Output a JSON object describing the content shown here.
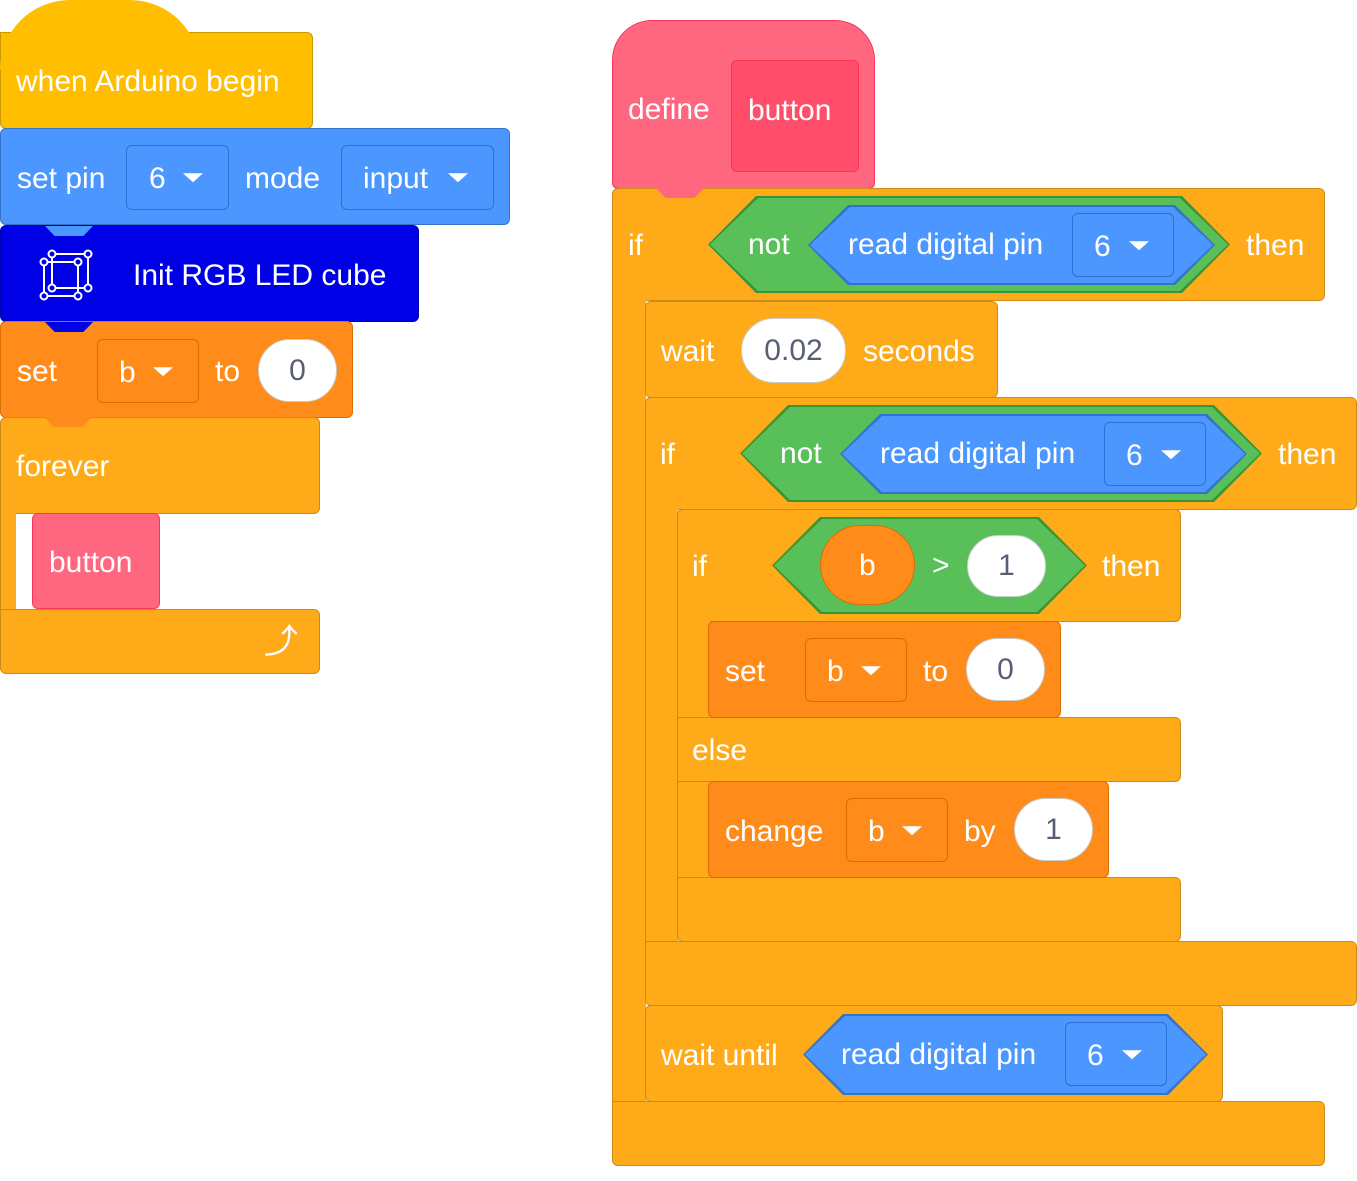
{
  "left_script": {
    "hat": "when Arduino begin",
    "set_pin": {
      "label": "set pin",
      "pin": "6",
      "mode_label": "mode",
      "mode": "input"
    },
    "init": {
      "label": "Init RGB LED cube",
      "icon": "led-cube-icon"
    },
    "set_var": {
      "label": "set",
      "var": "b",
      "to": "to",
      "value": "0"
    },
    "forever": {
      "label": "forever",
      "call": "button",
      "icon": "loop-arrow-icon"
    }
  },
  "right_script": {
    "define": {
      "label": "define",
      "name": "button"
    },
    "if1": {
      "if": "if",
      "not": "not",
      "read": "read digital pin",
      "pin": "6",
      "then": "then"
    },
    "wait": {
      "label": "wait",
      "value": "0.02",
      "unit": "seconds"
    },
    "if2": {
      "if": "if",
      "not": "not",
      "read": "read digital pin",
      "pin": "6",
      "then": "then"
    },
    "if3": {
      "if": "if",
      "var": "b",
      "op": ">",
      "value": "1",
      "then": "then",
      "else": "else"
    },
    "set_var": {
      "label": "set",
      "var": "b",
      "to": "to",
      "value": "0"
    },
    "change": {
      "label": "change",
      "var": "b",
      "by": "by",
      "value": "1"
    },
    "wait_until": {
      "label": "wait until",
      "read": "read digital pin",
      "pin": "6"
    }
  },
  "colors": {
    "events": "#FFBF00",
    "pins": "#4C97FF",
    "cube": "#0000E6",
    "variables": "#FF8C1A",
    "control": "#FFAB19",
    "custom": "#FF6680",
    "operators": "#59C059"
  }
}
